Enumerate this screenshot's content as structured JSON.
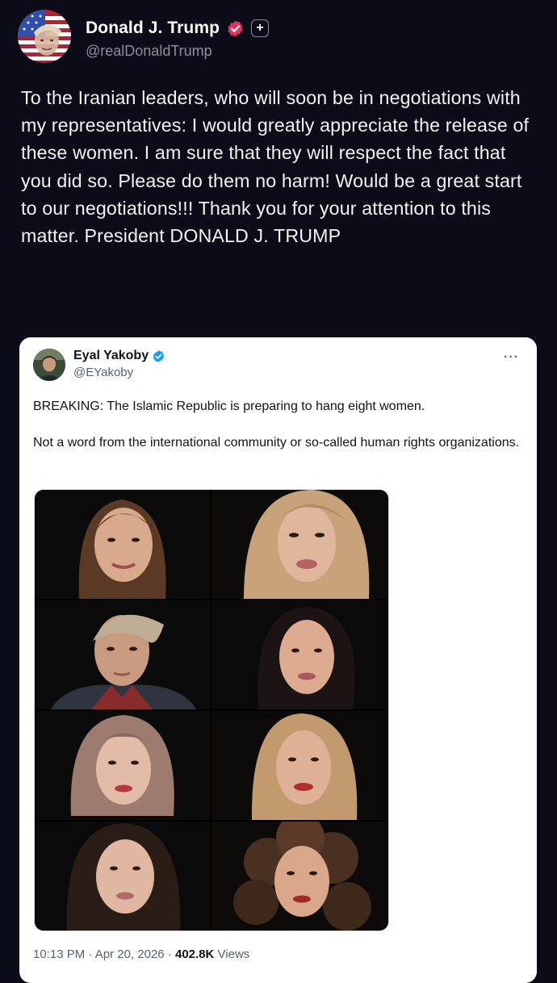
{
  "post": {
    "author_name": "Donald J. Trump",
    "author_handle": "@realDonaldTrump",
    "follow_glyph": "+",
    "text": "To the Iranian leaders, who will soon be in negotiations with my representatives: I would greatly appreciate the release of these women. I am sure that they will respect the fact that you did so. Please do them no harm! Would be a great start to our negotiations!!! Thank you for your attention to this matter. President DONALD J. TRUMP",
    "verified_color": "#e5305f"
  },
  "embedded_tweet": {
    "author_name": "Eyal Yakoby",
    "author_handle": "@EYakoby",
    "more_glyph": "···",
    "paragraphs": [
      "BREAKING: The Islamic Republic is preparing to hang eight women.",
      "Not a word from the international community or so-called human rights organizations."
    ],
    "photo_count": 8,
    "meta": {
      "time": "10:13 PM",
      "separator": " · ",
      "date": "Apr 20, 2026",
      "views_count": "402.8K",
      "views_label": "Views"
    },
    "verified_color": "#1d9bf0"
  }
}
